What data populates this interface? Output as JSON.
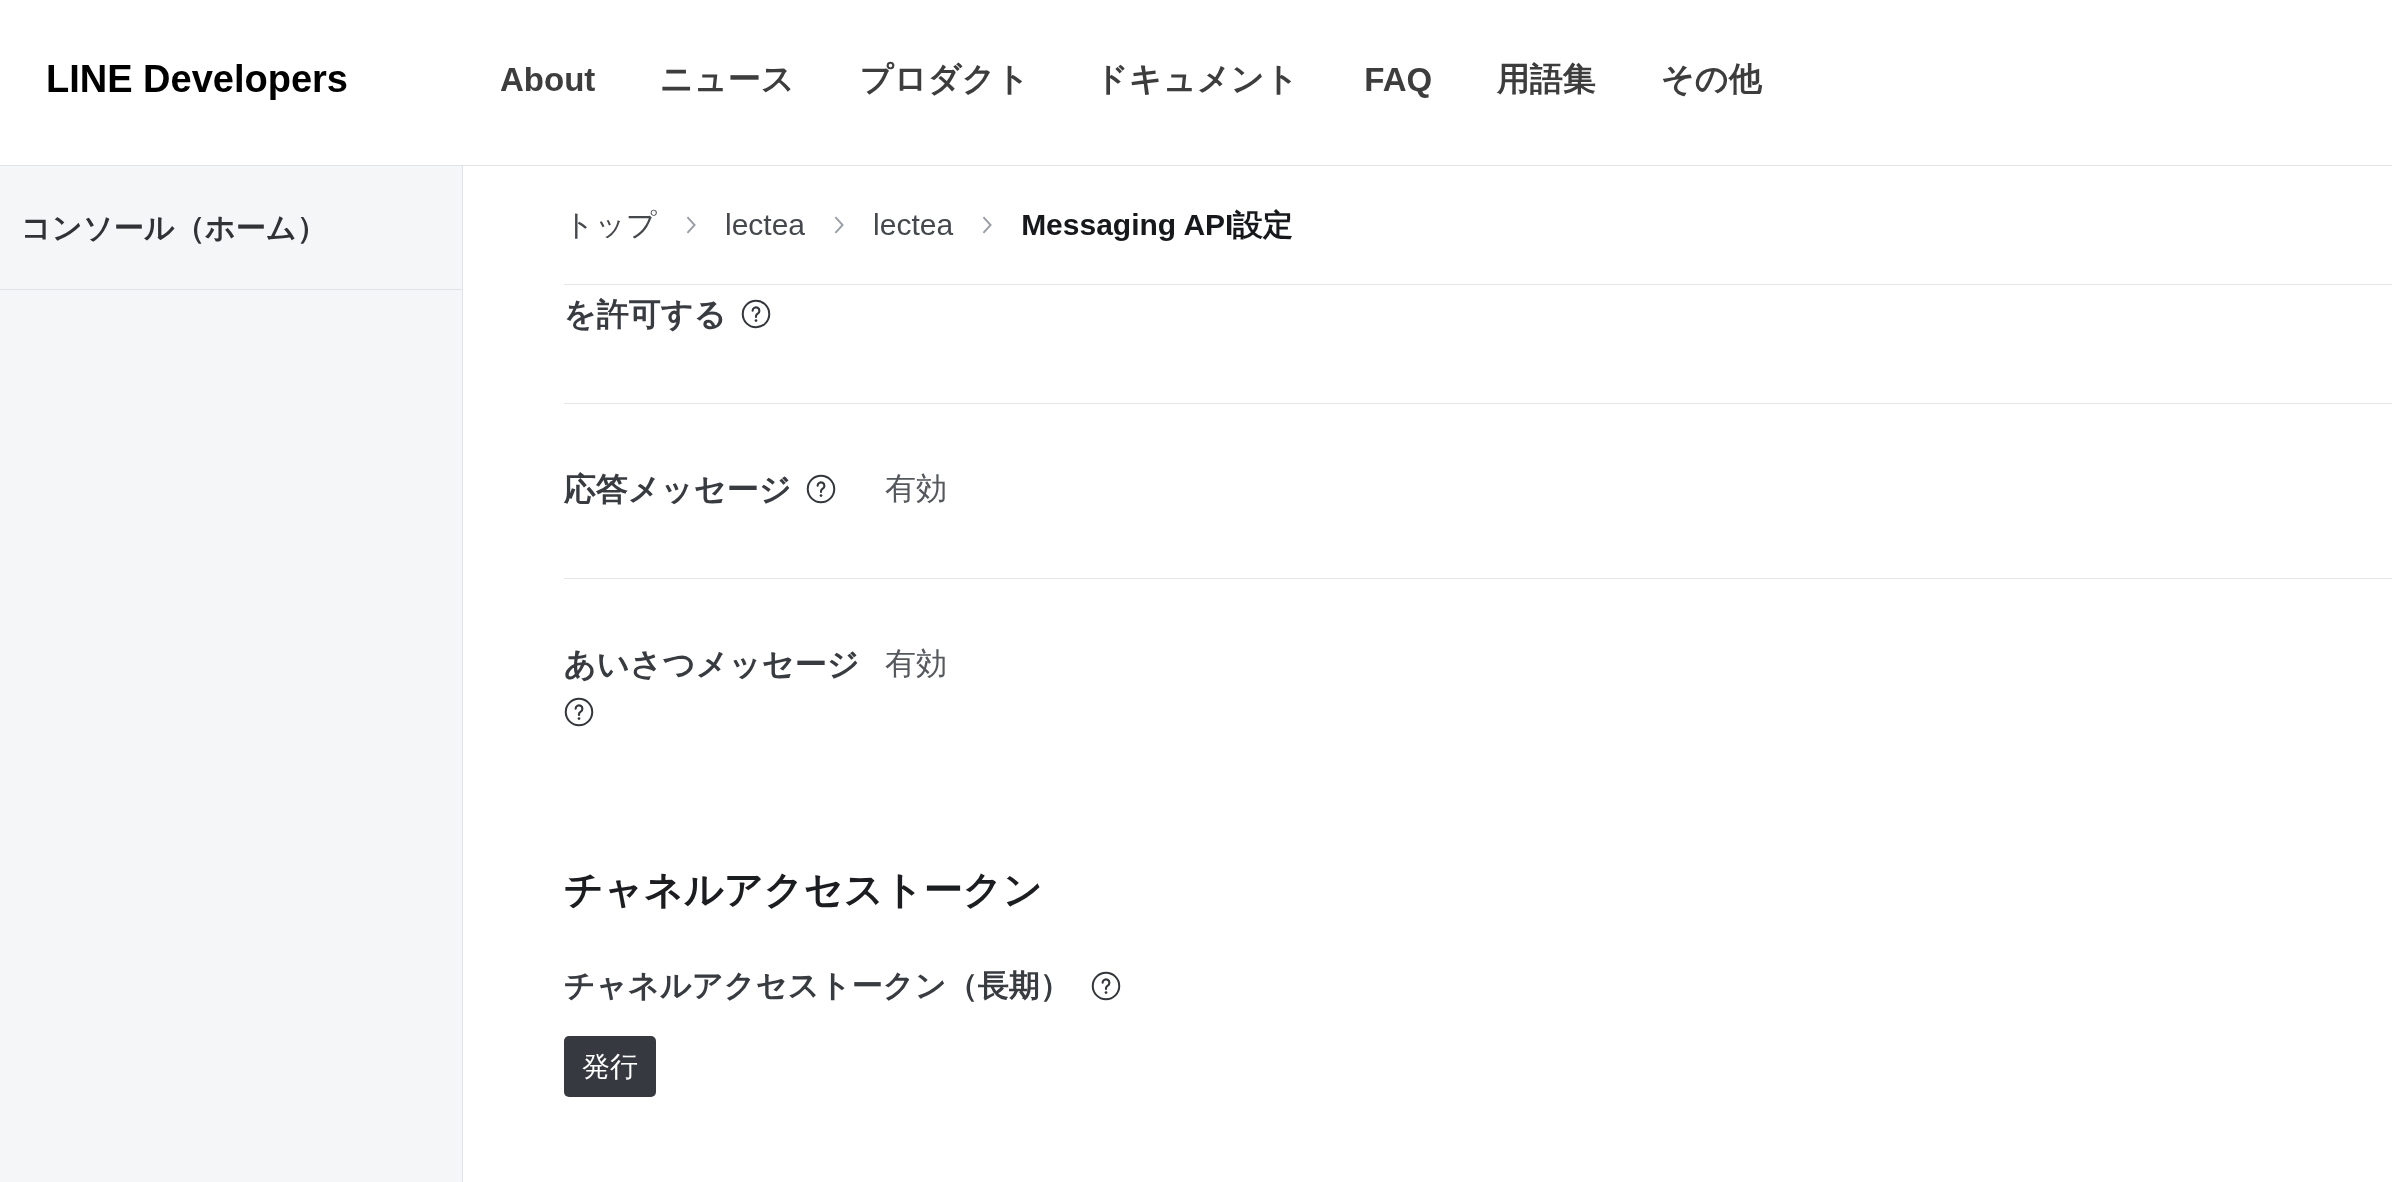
{
  "header": {
    "logo": "LINE Developers",
    "nav": [
      "About",
      "ニュース",
      "プロダクト",
      "ドキュメント",
      "FAQ",
      "用語集",
      "その他"
    ]
  },
  "sidebar": {
    "items": [
      {
        "label": "コンソール（ホーム）"
      }
    ]
  },
  "breadcrumb": [
    {
      "label": "トップ",
      "current": false
    },
    {
      "label": "lectea",
      "current": false
    },
    {
      "label": "lectea",
      "current": false
    },
    {
      "label": "Messaging API設定",
      "current": true
    }
  ],
  "settings": [
    {
      "label": "を許可する"
    },
    {
      "label": "応答メッセージ",
      "value": "有効"
    },
    {
      "label": "あいさつメッセージ",
      "value": "有効"
    }
  ],
  "channel_access_token": {
    "heading": "チャネルアクセストークン",
    "field_label": "チャネルアクセストークン（長期）",
    "button": "発行"
  }
}
